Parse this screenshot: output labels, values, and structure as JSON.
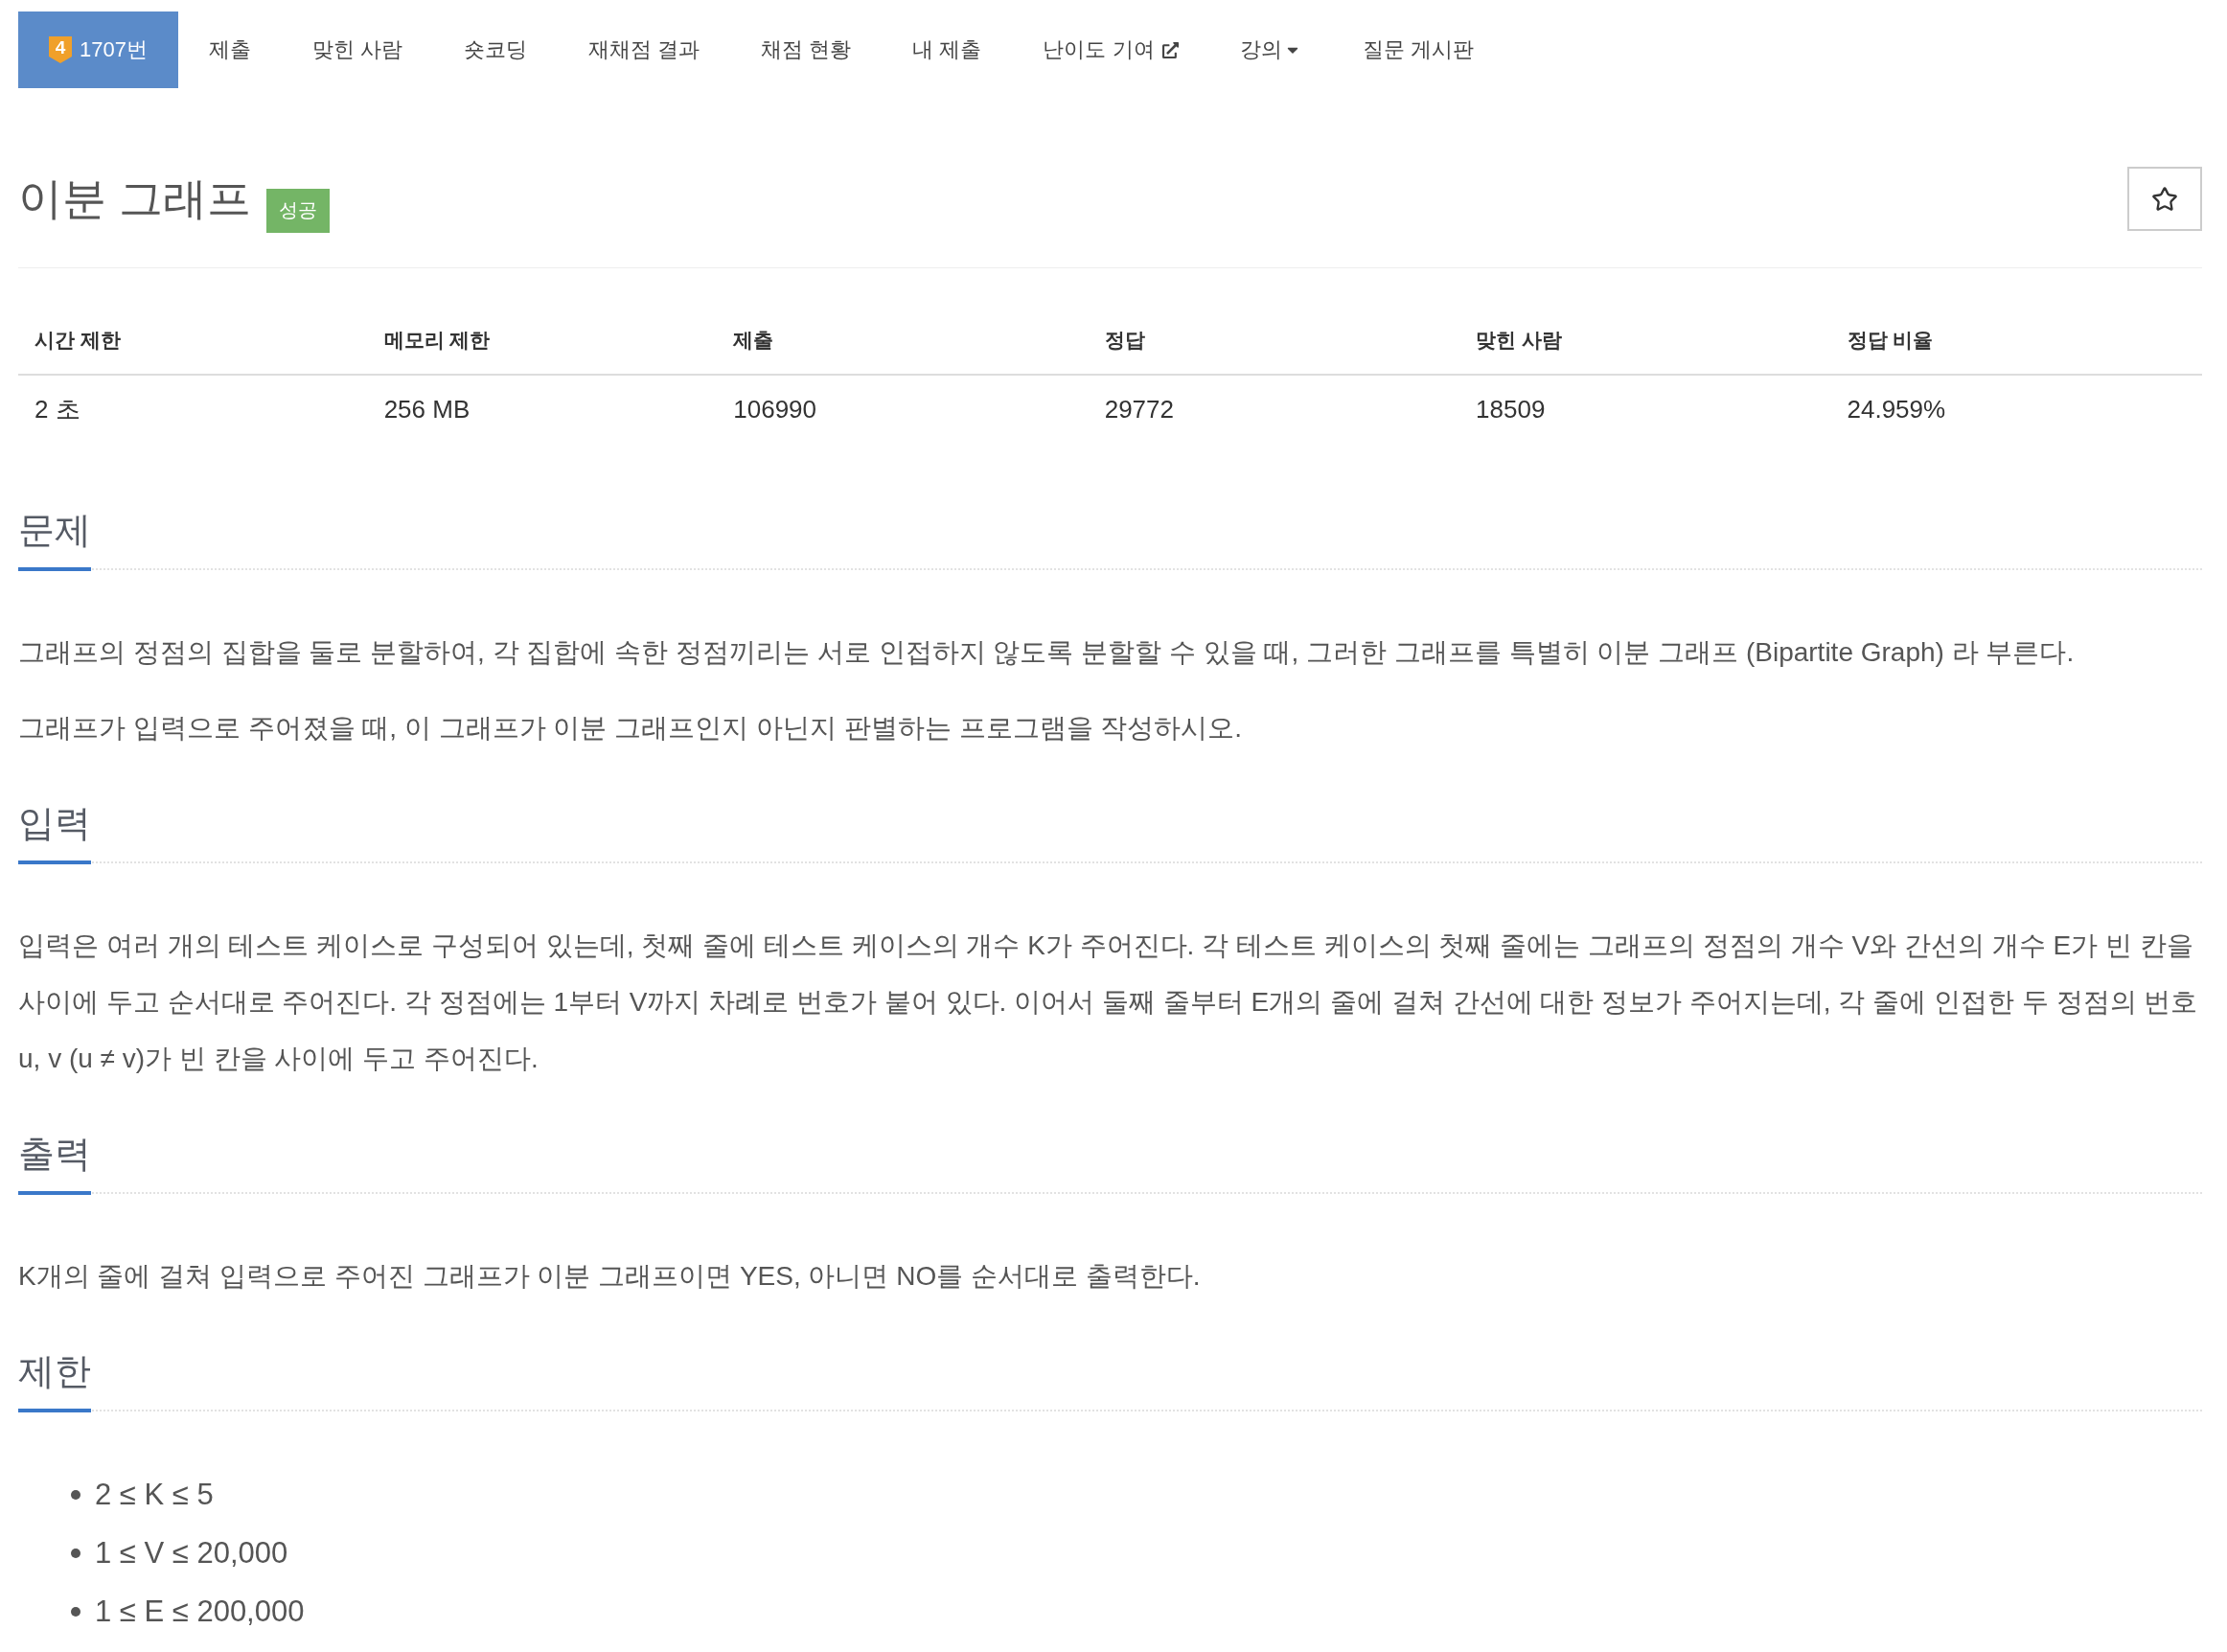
{
  "nav": {
    "tabs": [
      {
        "label": "1707번",
        "badge": "4",
        "kind": "link",
        "selected": true
      },
      {
        "label": "제출",
        "kind": "link",
        "selected": false
      },
      {
        "label": "맞힌 사람",
        "kind": "link",
        "selected": false
      },
      {
        "label": "숏코딩",
        "kind": "link",
        "selected": false
      },
      {
        "label": "재채점 결과",
        "kind": "link",
        "selected": false
      },
      {
        "label": "채점 현황",
        "kind": "link",
        "selected": false
      },
      {
        "label": "내 제출",
        "kind": "link",
        "selected": false
      },
      {
        "label": "난이도 기여",
        "kind": "external",
        "selected": false
      },
      {
        "label": "강의",
        "kind": "dropdown",
        "selected": false
      },
      {
        "label": "질문 게시판",
        "kind": "link",
        "selected": false
      }
    ]
  },
  "problem": {
    "title": "이분 그래프",
    "result_label": "성공",
    "starred": false
  },
  "info_table": {
    "columns": [
      "시간 제한",
      "메모리 제한",
      "제출",
      "정답",
      "맞힌 사람",
      "정답 비율"
    ],
    "rows": [
      [
        "2 초",
        "256 MB",
        "106990",
        "29772",
        "18509",
        "24.959%"
      ]
    ]
  },
  "sections": [
    {
      "heading": "문제",
      "kind": "text",
      "paragraphs": [
        "그래프의 정점의 집합을 둘로 분할하여, 각 집합에 속한 정점끼리는 서로 인접하지 않도록 분할할 수 있을 때, 그러한 그래프를 특별히 이분 그래프 (Bipartite Graph) 라 부른다.",
        "그래프가 입력으로 주어졌을 때, 이 그래프가 이분 그래프인지 아닌지 판별하는 프로그램을 작성하시오."
      ]
    },
    {
      "heading": "입력",
      "kind": "text",
      "paragraphs": [
        "입력은 여러 개의 테스트 케이스로 구성되어 있는데, 첫째 줄에 테스트 케이스의 개수 K가 주어진다. 각 테스트 케이스의 첫째 줄에는 그래프의 정점의 개수 V와 간선의 개수 E가 빈 칸을 사이에 두고 순서대로 주어진다. 각 정점에는 1부터 V까지 차례로 번호가 붙어 있다. 이어서 둘째 줄부터 E개의 줄에 걸쳐 간선에 대한 정보가 주어지는데, 각 줄에 인접한 두 정점의 번호 u, v (u ≠ v)가 빈 칸을 사이에 두고 주어진다."
      ]
    },
    {
      "heading": "출력",
      "kind": "text",
      "paragraphs": [
        "K개의 줄에 걸쳐 입력으로 주어진 그래프가 이분 그래프이면 YES, 아니면 NO를 순서대로 출력한다."
      ]
    },
    {
      "heading": "제한",
      "kind": "list",
      "items": [
        "2 ≤ K ≤ 5",
        "1 ≤ V ≤ 20,000",
        "1 ≤ E ≤ 200,000"
      ]
    }
  ]
}
